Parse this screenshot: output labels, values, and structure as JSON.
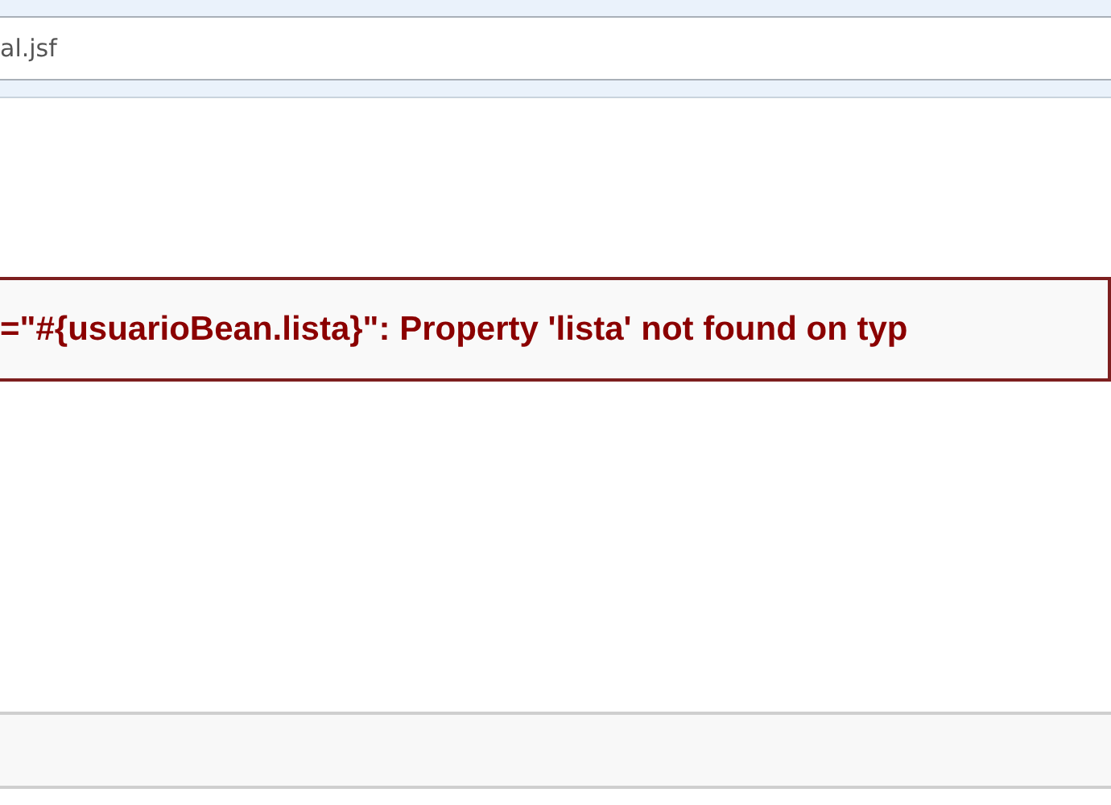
{
  "address_bar": {
    "value": "al.jsf"
  },
  "error_message": {
    "text": "=\"#{usuarioBean.lista}\": Property 'lista' not found on typ"
  }
}
